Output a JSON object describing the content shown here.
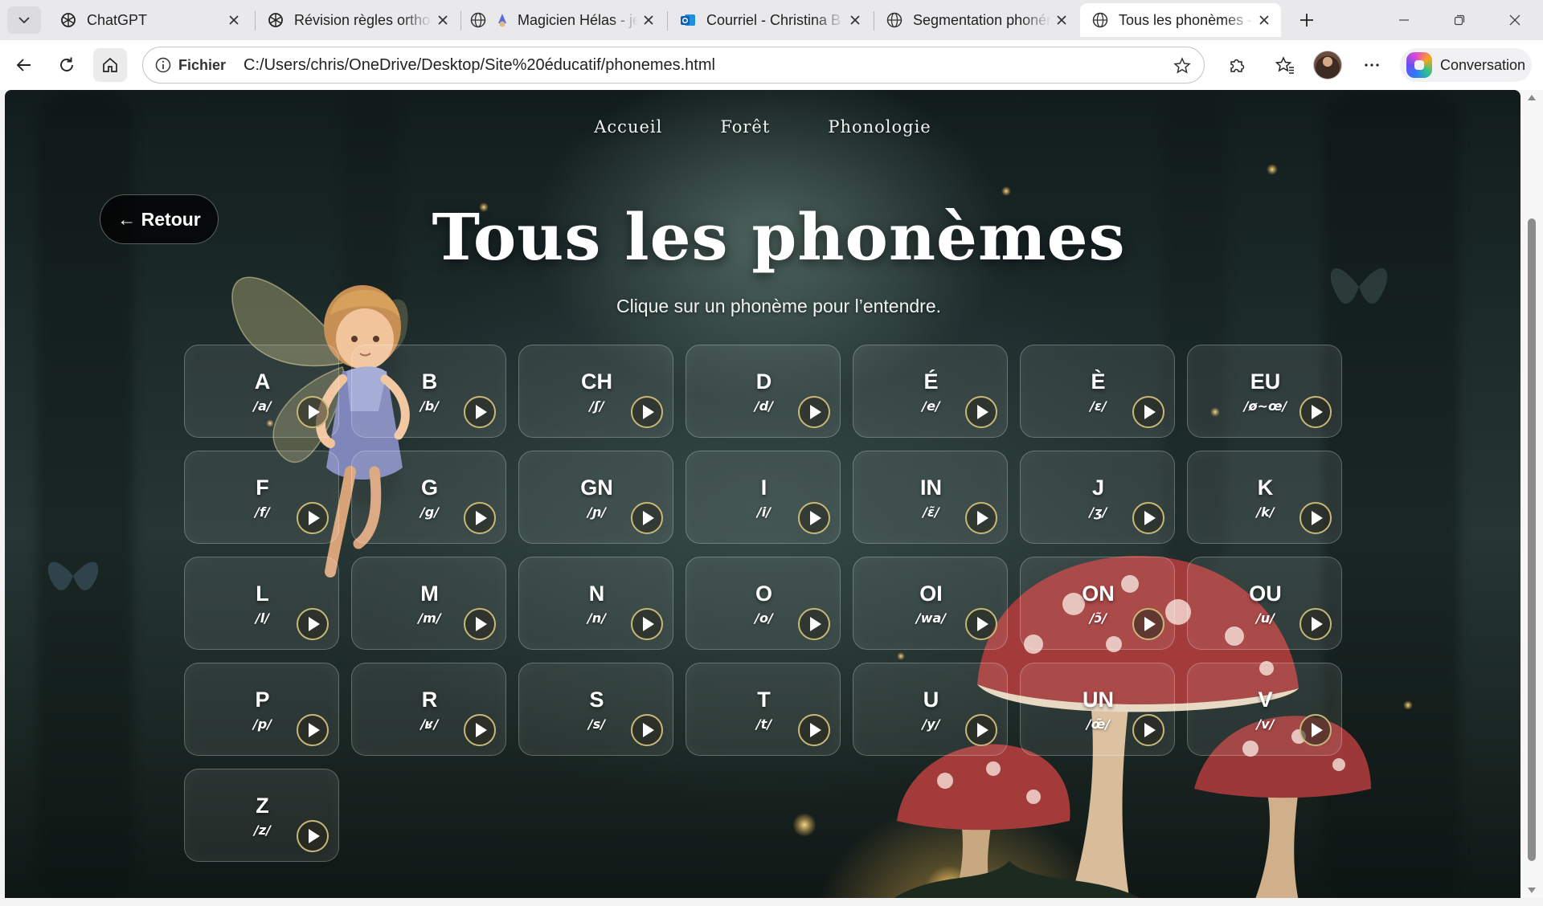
{
  "browser": {
    "tabs": [
      {
        "title": "ChatGPT",
        "icon": "chatgpt-icon",
        "active": false
      },
      {
        "title": "Révision règles orthographiques",
        "icon": "chatgpt-icon",
        "active": false
      },
      {
        "title": "Magicien Hélas - jeu",
        "icon": "globe-icon",
        "active": false
      },
      {
        "title": "Courriel - Christina B",
        "icon": "outlook-icon",
        "active": false
      },
      {
        "title": "Segmentation phonémique",
        "icon": "globe-icon",
        "active": false
      },
      {
        "title": "Tous les phonèmes - Site",
        "icon": "globe-icon",
        "active": true
      }
    ],
    "address": {
      "scheme": "Fichier",
      "url": "C:/Users/chris/OneDrive/Desktop/Site%20éducatif/phonemes.html"
    },
    "copilot_label": "Conversation"
  },
  "page": {
    "nav": [
      "Accueil",
      "Forêt",
      "Phonologie"
    ],
    "back_label": "← Retour",
    "title": "Tous les phonèmes",
    "subtitle": "Clique sur un phonème pour l’entendre.",
    "phonemes": [
      {
        "letter": "A",
        "ipa": "/a/"
      },
      {
        "letter": "B",
        "ipa": "/b/"
      },
      {
        "letter": "CH",
        "ipa": "/ʃ/"
      },
      {
        "letter": "D",
        "ipa": "/d/"
      },
      {
        "letter": "É",
        "ipa": "/e/"
      },
      {
        "letter": "È",
        "ipa": "/ɛ/"
      },
      {
        "letter": "EU",
        "ipa": "/ø~œ/"
      },
      {
        "letter": "F",
        "ipa": "/f/"
      },
      {
        "letter": "G",
        "ipa": "/g/"
      },
      {
        "letter": "GN",
        "ipa": "/ɲ/"
      },
      {
        "letter": "I",
        "ipa": "/i/"
      },
      {
        "letter": "IN",
        "ipa": "/ɛ̃/"
      },
      {
        "letter": "J",
        "ipa": "/ʒ/"
      },
      {
        "letter": "K",
        "ipa": "/k/"
      },
      {
        "letter": "L",
        "ipa": "/l/"
      },
      {
        "letter": "M",
        "ipa": "/m/"
      },
      {
        "letter": "N",
        "ipa": "/n/"
      },
      {
        "letter": "O",
        "ipa": "/o/"
      },
      {
        "letter": "OI",
        "ipa": "/wa/"
      },
      {
        "letter": "ON",
        "ipa": "/ɔ̃/"
      },
      {
        "letter": "OU",
        "ipa": "/u/"
      },
      {
        "letter": "P",
        "ipa": "/p/"
      },
      {
        "letter": "R",
        "ipa": "/ʁ/"
      },
      {
        "letter": "S",
        "ipa": "/s/"
      },
      {
        "letter": "T",
        "ipa": "/t/"
      },
      {
        "letter": "U",
        "ipa": "/y/"
      },
      {
        "letter": "UN",
        "ipa": "/œ̃/"
      },
      {
        "letter": "V",
        "ipa": "/v/"
      },
      {
        "letter": "Z",
        "ipa": "/z/"
      }
    ]
  },
  "colors": {
    "play_ring": "#c8b878",
    "tab_strip": "#e9e9ec"
  }
}
